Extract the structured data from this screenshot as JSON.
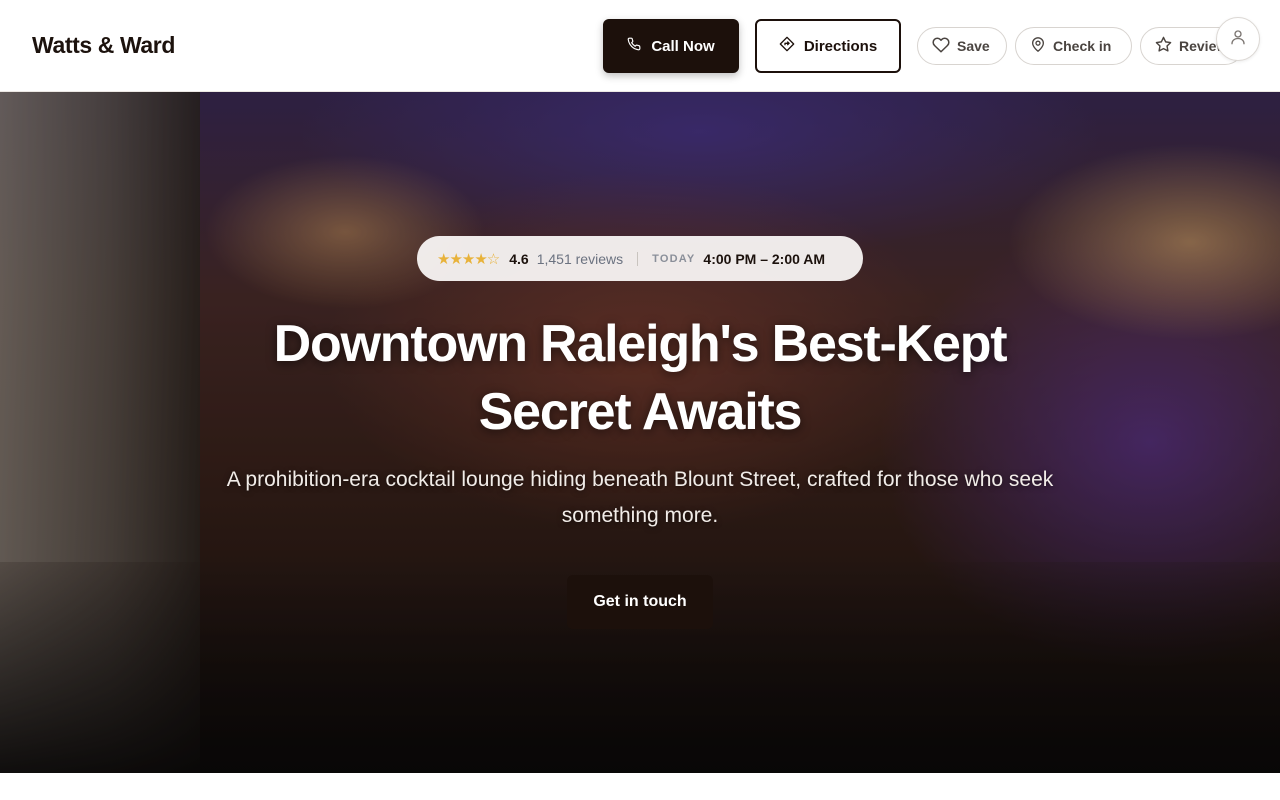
{
  "brand": {
    "name": "Watts & Ward"
  },
  "header": {
    "call_label": "Call Now",
    "directions_label": "Directions",
    "save_label": "Save",
    "checkin_label": "Check in",
    "review_label": "Review",
    "icons": {
      "call": "phone-icon",
      "directions": "directions-icon",
      "save": "heart-icon",
      "checkin": "map-pin-icon",
      "review": "star-icon",
      "account": "user-icon"
    }
  },
  "hero": {
    "rating": {
      "stars": "★★★★☆",
      "value": "4.6",
      "reviews": "1,451 reviews",
      "score": 4.6,
      "max": 5
    },
    "hours": {
      "label": "TODAY",
      "value": "4:00 PM – 2:00 AM"
    },
    "headline_line1": "Downtown Raleigh's Best-Kept",
    "headline_line2": "Secret Awaits",
    "subheadline": "A prohibition-era cocktail lounge hiding beneath Blount Street, crafted for those who seek something more.",
    "cta_label": "Get in touch"
  },
  "colors": {
    "primary": "#1c100b",
    "star": "#e8b23a",
    "muted_text": "#6b7280"
  }
}
